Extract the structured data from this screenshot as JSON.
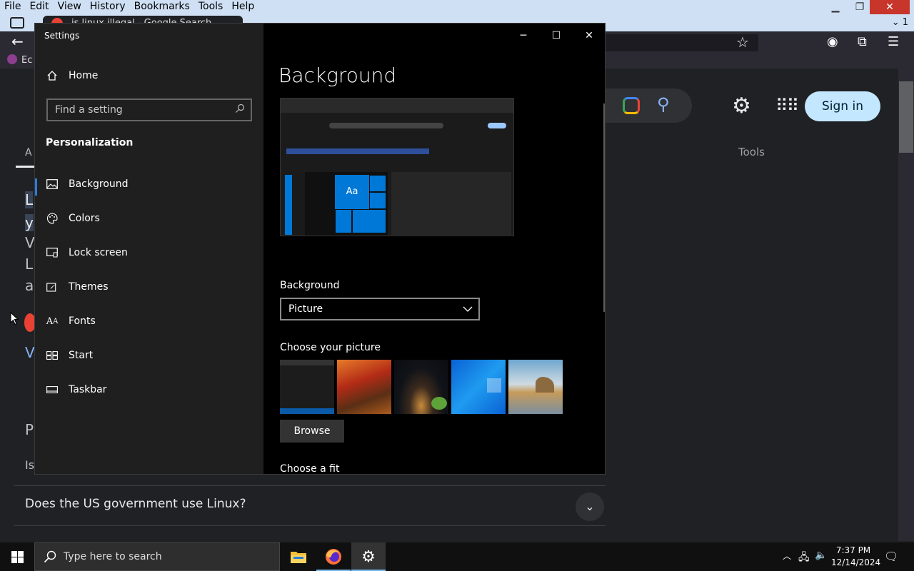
{
  "firefox": {
    "menu": [
      "File",
      "Edit",
      "View",
      "History",
      "Bookmarks",
      "Tools",
      "Help"
    ],
    "tab_title": "is linux illegal - Google Search",
    "tab_count": "1",
    "bookmark_label": "Ec"
  },
  "google": {
    "signin": "Sign in",
    "tools": "Tools",
    "frag_a": "A",
    "frag_1": "L",
    "frag_2": "y",
    "frag_3": "V",
    "frag_4": "L",
    "frag_5": "a",
    "frag_6": "V",
    "frag_7": "P",
    "frag_8": "Is",
    "faq_1": "Does the US government use Linux?"
  },
  "settings": {
    "window_title": "Settings",
    "home": "Home",
    "search_placeholder": "Find a setting",
    "section": "Personalization",
    "nav": [
      {
        "label": "Background",
        "icon": "picture-icon"
      },
      {
        "label": "Colors",
        "icon": "palette-icon"
      },
      {
        "label": "Lock screen",
        "icon": "lock-screen-icon"
      },
      {
        "label": "Themes",
        "icon": "brush-icon"
      },
      {
        "label": "Fonts",
        "icon": "font-icon"
      },
      {
        "label": "Start",
        "icon": "start-icon"
      },
      {
        "label": "Taskbar",
        "icon": "taskbar-icon"
      }
    ],
    "active": "Background",
    "page_title": "Background",
    "preview_tile": "Aa",
    "background_label": "Background",
    "background_value": "Picture",
    "choose_picture_label": "Choose your picture",
    "browse": "Browse",
    "choose_fit_label": "Choose a fit"
  },
  "taskbar": {
    "search_placeholder": "Type here to search",
    "time": "7:37 PM",
    "date": "12/14/2024"
  },
  "colors": {
    "accent": "#0078d7",
    "signin_bg": "#c2e7ff"
  }
}
